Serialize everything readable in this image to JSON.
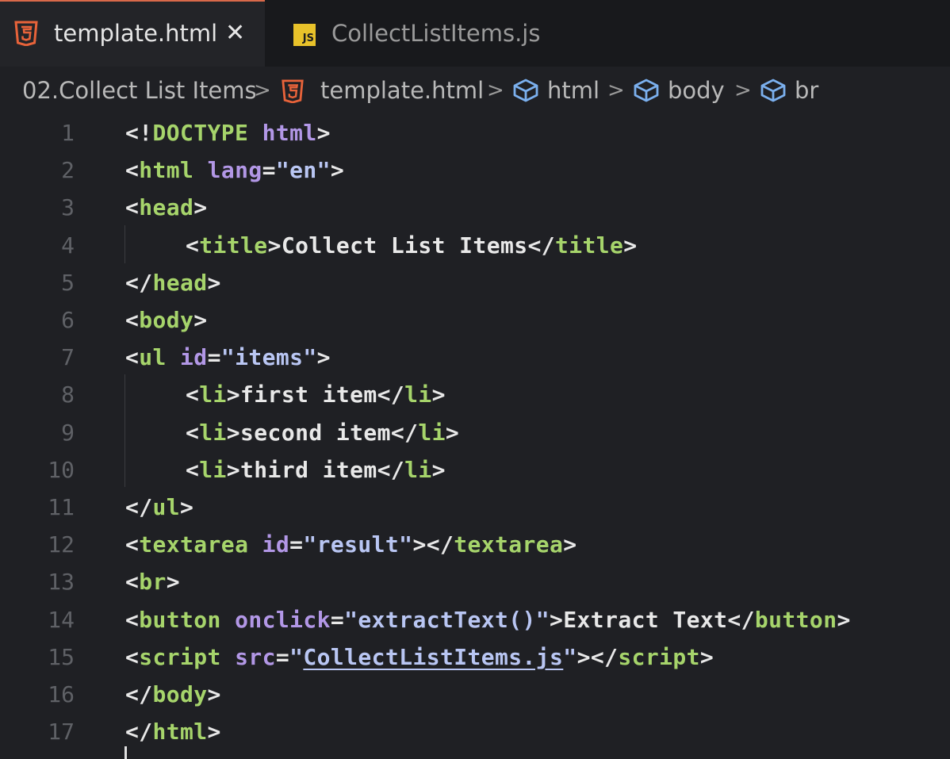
{
  "tabs": [
    {
      "label": "template.html",
      "icon": "html5-icon",
      "active": true
    },
    {
      "label": "CollectListItems.js",
      "icon": "js-file-icon",
      "active": false
    }
  ],
  "close_glyph": "✕",
  "breadcrumb": {
    "folder": "02.Collect List Items",
    "file": "template.html",
    "html": "html",
    "body": "body",
    "br": "br",
    "sep": ">"
  },
  "js_icon_text": "JS",
  "lines": [
    {
      "n": "1",
      "tokens": [
        [
          "<!",
          "p"
        ],
        [
          "DOCTYPE",
          "t"
        ],
        [
          " ",
          "x"
        ],
        [
          "html",
          "a"
        ],
        [
          ">",
          "p"
        ]
      ]
    },
    {
      "n": "2",
      "tokens": [
        [
          "<",
          "p"
        ],
        [
          "html",
          "t"
        ],
        [
          " ",
          "x"
        ],
        [
          "lang",
          "a"
        ],
        [
          "=",
          "p"
        ],
        [
          "\"en\"",
          "s"
        ],
        [
          ">",
          "p"
        ]
      ]
    },
    {
      "n": "3",
      "tokens": [
        [
          "<",
          "p"
        ],
        [
          "head",
          "t"
        ],
        [
          ">",
          "p"
        ]
      ]
    },
    {
      "n": "4",
      "indent": true,
      "tokens": [
        [
          "<",
          "p"
        ],
        [
          "title",
          "t"
        ],
        [
          ">",
          "p"
        ],
        [
          "Collect List Items",
          "x"
        ],
        [
          "</",
          "p"
        ],
        [
          "title",
          "t"
        ],
        [
          ">",
          "p"
        ]
      ]
    },
    {
      "n": "5",
      "tokens": [
        [
          "</",
          "p"
        ],
        [
          "head",
          "t"
        ],
        [
          ">",
          "p"
        ]
      ]
    },
    {
      "n": "6",
      "tokens": [
        [
          "<",
          "p"
        ],
        [
          "body",
          "t"
        ],
        [
          ">",
          "p"
        ]
      ]
    },
    {
      "n": "7",
      "tokens": [
        [
          "<",
          "p"
        ],
        [
          "ul",
          "t"
        ],
        [
          " ",
          "x"
        ],
        [
          "id",
          "a"
        ],
        [
          "=",
          "p"
        ],
        [
          "\"items\"",
          "s"
        ],
        [
          ">",
          "p"
        ]
      ]
    },
    {
      "n": "8",
      "indent": true,
      "tokens": [
        [
          "<",
          "p"
        ],
        [
          "li",
          "t"
        ],
        [
          ">",
          "p"
        ],
        [
          "first item",
          "x"
        ],
        [
          "</",
          "p"
        ],
        [
          "li",
          "t"
        ],
        [
          ">",
          "p"
        ]
      ]
    },
    {
      "n": "9",
      "indent": true,
      "tokens": [
        [
          "<",
          "p"
        ],
        [
          "li",
          "t"
        ],
        [
          ">",
          "p"
        ],
        [
          "second item",
          "x"
        ],
        [
          "</",
          "p"
        ],
        [
          "li",
          "t"
        ],
        [
          ">",
          "p"
        ]
      ]
    },
    {
      "n": "10",
      "indent": true,
      "tokens": [
        [
          "<",
          "p"
        ],
        [
          "li",
          "t"
        ],
        [
          ">",
          "p"
        ],
        [
          "third item",
          "x"
        ],
        [
          "</",
          "p"
        ],
        [
          "li",
          "t"
        ],
        [
          ">",
          "p"
        ]
      ]
    },
    {
      "n": "11",
      "tokens": [
        [
          "</",
          "p"
        ],
        [
          "ul",
          "t"
        ],
        [
          ">",
          "p"
        ]
      ]
    },
    {
      "n": "12",
      "tokens": [
        [
          "<",
          "p"
        ],
        [
          "textarea",
          "t"
        ],
        [
          " ",
          "x"
        ],
        [
          "id",
          "a"
        ],
        [
          "=",
          "p"
        ],
        [
          "\"result\"",
          "s"
        ],
        [
          "></",
          "p"
        ],
        [
          "textarea",
          "t"
        ],
        [
          ">",
          "p"
        ]
      ]
    },
    {
      "n": "13",
      "tokens": [
        [
          "<",
          "p"
        ],
        [
          "br",
          "t"
        ],
        [
          ">",
          "p"
        ]
      ]
    },
    {
      "n": "14",
      "tokens": [
        [
          "<",
          "p"
        ],
        [
          "button",
          "t"
        ],
        [
          " ",
          "x"
        ],
        [
          "onclick",
          "a"
        ],
        [
          "=",
          "p"
        ],
        [
          "\"extractText()\"",
          "s"
        ],
        [
          ">",
          "p"
        ],
        [
          "Extract Text",
          "x"
        ],
        [
          "</",
          "p"
        ],
        [
          "button",
          "t"
        ],
        [
          ">",
          "p"
        ]
      ]
    },
    {
      "n": "15",
      "tokens": [
        [
          "<",
          "p"
        ],
        [
          "script",
          "t"
        ],
        [
          " ",
          "x"
        ],
        [
          "src",
          "a"
        ],
        [
          "=",
          "p"
        ],
        [
          "\"",
          "s"
        ],
        [
          "CollectListItems.js",
          "l"
        ],
        [
          "\"",
          "s"
        ],
        [
          "></",
          "p"
        ],
        [
          "script",
          "t"
        ],
        [
          ">",
          "p"
        ]
      ]
    },
    {
      "n": "16",
      "tokens": [
        [
          "</",
          "p"
        ],
        [
          "body",
          "t"
        ],
        [
          ">",
          "p"
        ]
      ]
    },
    {
      "n": "17",
      "tokens": [
        [
          "</",
          "p"
        ],
        [
          "html",
          "t"
        ],
        [
          ">",
          "p"
        ]
      ]
    }
  ],
  "colors": {
    "tag": "#a6d46b",
    "attribute": "#b297e6",
    "string": "#b9c6f3",
    "text": "#e8e8e8",
    "line_number": "#5f6166",
    "html_icon": "#e8633a",
    "js_icon": "#e8c22a"
  }
}
